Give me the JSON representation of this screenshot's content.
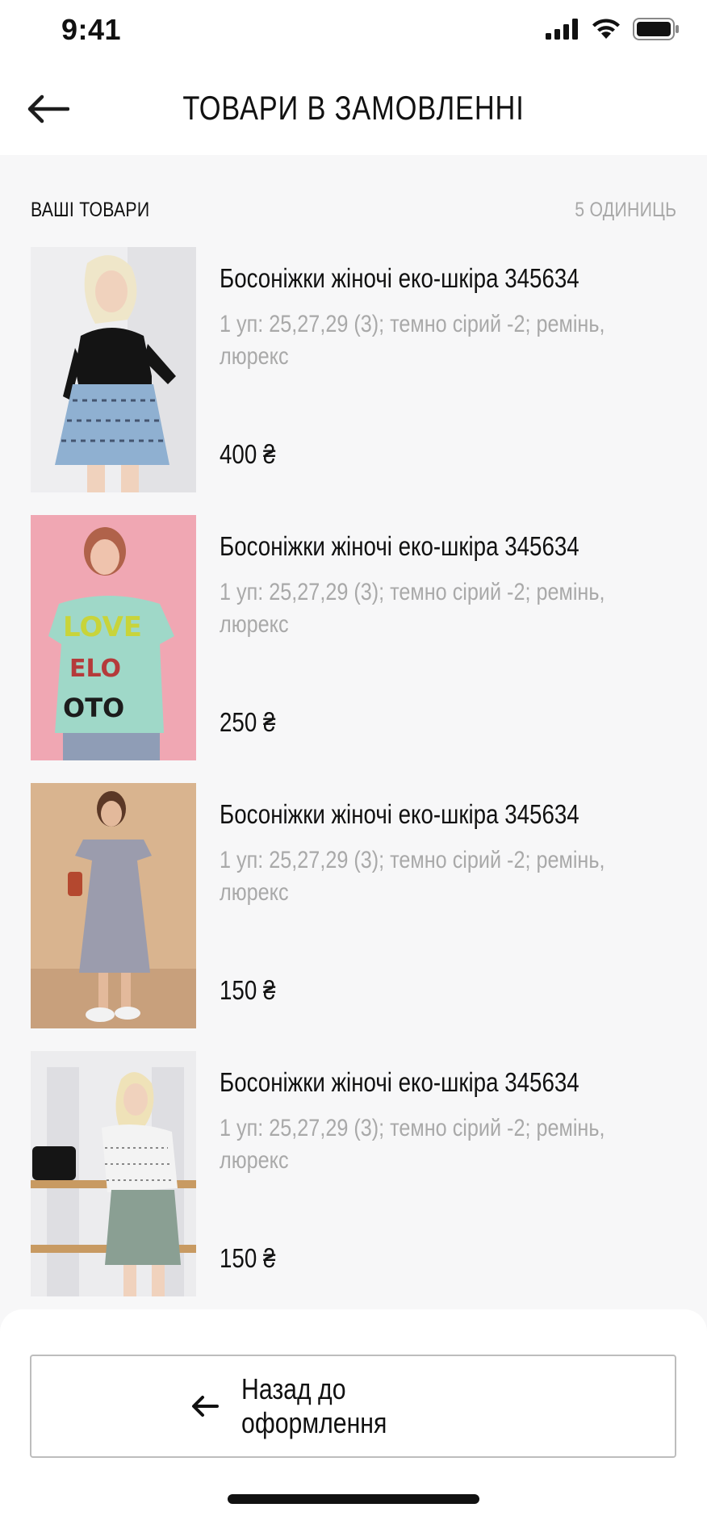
{
  "status_bar": {
    "time": "9:41"
  },
  "header": {
    "title": "ТОВАРИ В ЗАМОВЛЕННІ"
  },
  "section": {
    "title": "ВАШІ ТОВАРИ",
    "count": "5 ОДИНИЦЬ"
  },
  "items": [
    {
      "name": "Босоніжки жіночі еко-шкіра 345634",
      "desc": "1 уп: 25,27,29 (3); темно сірий -2; ремінь, люрекс",
      "price": "400 ₴"
    },
    {
      "name": "Босоніжки жіночі еко-шкіра 345634",
      "desc": "1 уп: 25,27,29 (3); темно сірий -2; ремінь, люрекс",
      "price": "250 ₴"
    },
    {
      "name": "Босоніжки жіночі еко-шкіра 345634",
      "desc": "1 уп: 25,27,29 (3); темно сірий -2; ремінь, люрекс",
      "price": "150 ₴"
    },
    {
      "name": "Босоніжки жіночі еко-шкіра 345634",
      "desc": "1 уп: 25,27,29 (3); темно сірий -2; ремінь, люрекс",
      "price": "150 ₴"
    }
  ],
  "footer": {
    "back_button_label": "Назад до оформлення"
  },
  "icons": {
    "header_back": "arrow-left-icon",
    "button_back": "arrow-left-icon",
    "signal": "cellular-signal-icon",
    "wifi": "wifi-icon",
    "battery": "battery-icon"
  },
  "colors": {
    "background": "#f7f7f8",
    "surface": "#ffffff",
    "text": "#111111",
    "muted_text": "#a9a9a9",
    "border": "#bdbdbd"
  }
}
